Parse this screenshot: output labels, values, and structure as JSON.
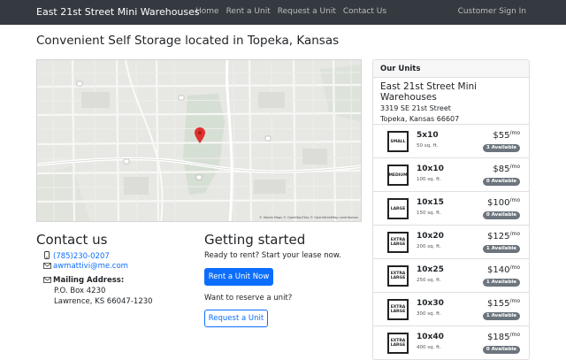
{
  "navbar": {
    "brand": "East 21st Street Mini Warehouses",
    "links": [
      "Home",
      "Rent a Unit",
      "Request a Unit",
      "Contact Us"
    ],
    "sign_in": "Customer Sign In"
  },
  "page_title": "Convenient Self Storage located in Topeka, Kansas",
  "map": {
    "credit": "© Stadia Maps © OpenMapTiles © OpenStreetMap contributors",
    "pin_color": "#e03030"
  },
  "contact": {
    "heading": "Contact us",
    "phone": "(785)230-0207",
    "email": "awmattivi@me.com",
    "mailing_label": "Mailing Address:",
    "address_line1": "P.O. Box 4230",
    "address_line2": "Lawrence, KS 66047-1230"
  },
  "getting_started": {
    "heading": "Getting started",
    "rent_prompt": "Ready to rent? Start your lease now.",
    "rent_button": "Rent a Unit Now",
    "reserve_prompt": "Want to reserve a unit?",
    "reserve_button": "Request a Unit"
  },
  "units": {
    "header": "Our Units",
    "facility_name": "East 21st Street Mini Warehouses",
    "facility_street": "3319 SE 21st Street",
    "facility_city": "Topeka, Kansas 66607",
    "items": [
      {
        "size_label": "SMALL",
        "dims": "5x10",
        "sqft": "50 sq. ft.",
        "price": "$55",
        "per": "/mo",
        "available": "3 Available"
      },
      {
        "size_label": "MEDIUM",
        "dims": "10x10",
        "sqft": "100 sq. ft.",
        "price": "$85",
        "per": "/mo",
        "available": "0 Available"
      },
      {
        "size_label": "LARGE",
        "dims": "10x15",
        "sqft": "150 sq. ft.",
        "price": "$100",
        "per": "/mo",
        "available": "0 Available"
      },
      {
        "size_label": "EXTRA LARGE",
        "dims": "10x20",
        "sqft": "200 sq. ft.",
        "price": "$125",
        "per": "/mo",
        "available": "1 Available"
      },
      {
        "size_label": "EXTRA LARGE",
        "dims": "10x25",
        "sqft": "250 sq. ft.",
        "price": "$140",
        "per": "/mo",
        "available": "1 Available"
      },
      {
        "size_label": "EXTRA LARGE",
        "dims": "10x30",
        "sqft": "300 sq. ft.",
        "price": "$155",
        "per": "/mo",
        "available": "1 Available"
      },
      {
        "size_label": "EXTRA LARGE",
        "dims": "10x40",
        "sqft": "400 sq. ft.",
        "price": "$185",
        "per": "/mo",
        "available": "0 Available"
      }
    ]
  },
  "colors": {
    "navbar_bg": "#343a40",
    "primary": "#0d6efd",
    "badge": "#6c757d"
  }
}
